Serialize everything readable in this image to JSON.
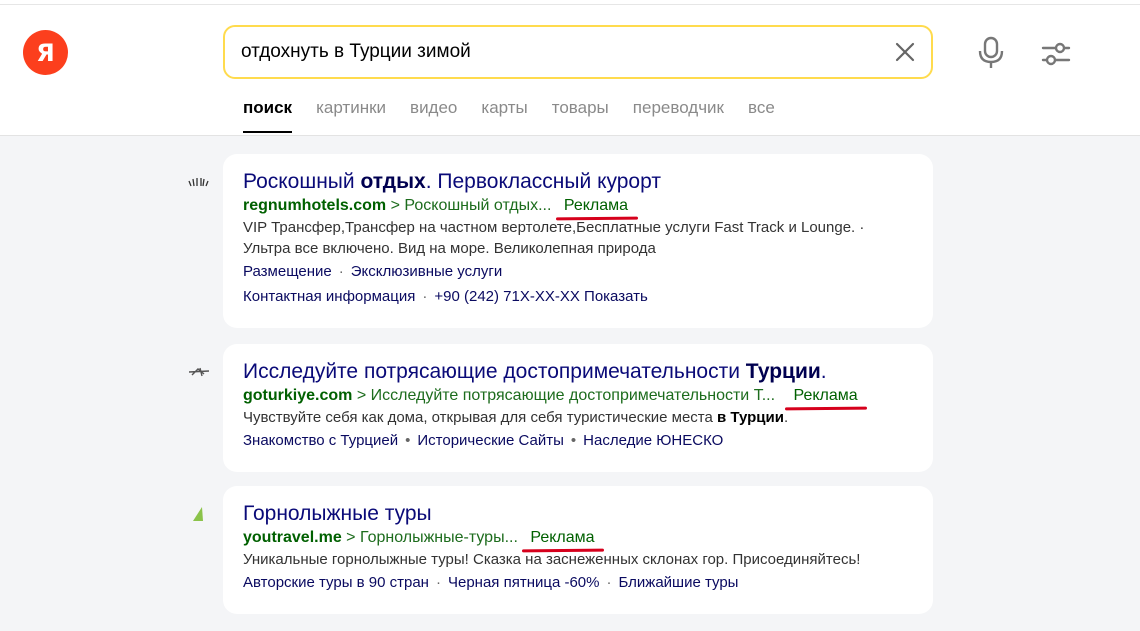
{
  "header": {
    "logo_letter": "Я",
    "search": {
      "value": "отдохнуть в Турции зимой"
    },
    "tabs": [
      {
        "label": "поиск"
      },
      {
        "label": "картинки"
      },
      {
        "label": "видео"
      },
      {
        "label": "карты"
      },
      {
        "label": "товары"
      },
      {
        "label": "переводчик"
      },
      {
        "label": "все"
      }
    ]
  },
  "results": [
    {
      "title_parts": [
        "Роскошный ",
        "отдых",
        ". Первоклассный курорт"
      ],
      "domain": "regnumhotels.com",
      "crumb_sep": ">",
      "crumb": "Роскошный отдых...",
      "ad_label": "Реклама",
      "desc_lines": [
        "VIP Трансфер,Трансфер на частном вертолете,Бесплатные услуги Fast Track и Lounge. ·",
        "Ультра все включено. Вид на море. Великолепная природа"
      ],
      "links_row1": [
        "Размещение",
        "Эксклюзивные услуги"
      ],
      "links_row1_sep": "·",
      "links_row2": [
        "Контактная информация",
        "+90 (242) 71X-XX-XX Показать"
      ],
      "links_row2_sep": "·"
    },
    {
      "title_parts": [
        "Исследуйте потрясающие достопримечательности ",
        "Турции",
        "."
      ],
      "domain": "goturkiye.com",
      "crumb_sep": ">",
      "crumb": "Исследуйте потрясающие достопримечательности Т...",
      "ad_label": "Реклама",
      "desc_parts": [
        "Чувствуйте себя как дома, открывая для себя туристические места ",
        "в Турции",
        "."
      ],
      "links": [
        "Знакомство с Турцией",
        "Исторические Сайты",
        "Наследие ЮНЕСКО"
      ],
      "links_sep": "•"
    },
    {
      "title": "Горнолыжные туры",
      "domain": "youtravel.me",
      "crumb_sep": ">",
      "crumb": "Горнолыжные-туры...",
      "ad_label": "Реклама",
      "desc": "Уникальные горнолыжные туры! Сказка на заснеженных склонах гор. Присоединяйтесь!",
      "links": [
        "Авторские туры в 90 стран",
        "Черная пятница -60%",
        "Ближайшие туры"
      ],
      "links_sep": "·"
    }
  ],
  "colors": {
    "logo": "#fc3f1d",
    "search_border": "#ffdb4d",
    "title": "#0a0a78",
    "domain": "#006000",
    "ad_underline": "#d6001c",
    "background": "#f4f5f7"
  },
  "icons": {
    "clear": "close-icon",
    "voice": "microphone-icon",
    "settings": "filter-settings-icon"
  }
}
